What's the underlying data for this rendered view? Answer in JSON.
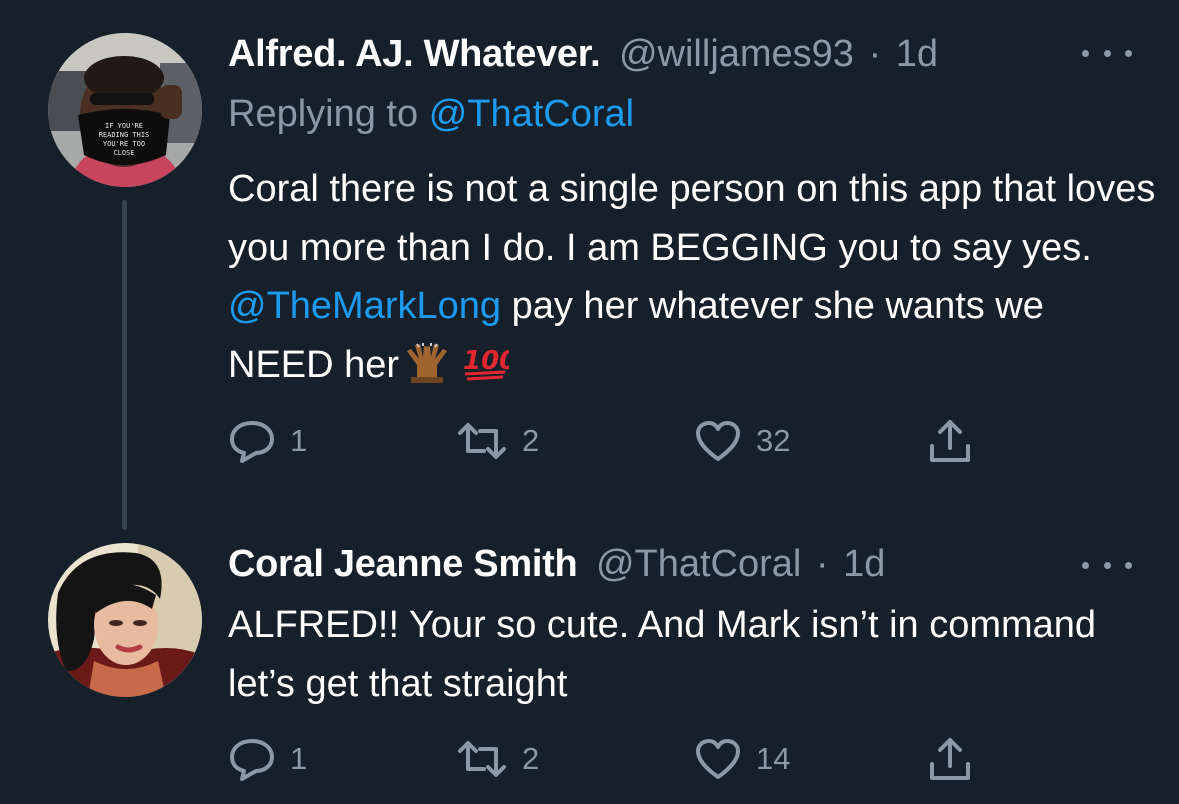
{
  "tweets": [
    {
      "display_name": "Alfred. AJ. Whatever.",
      "handle": "@willjames93",
      "separator": "·",
      "time": "1d",
      "replying_prefix": "Replying to",
      "replying_to": "@ThatCoral",
      "text_part1": "Coral there is not a single person on this app that loves you more than I do. I am BEGGING you to say yes.",
      "mention": "@TheMarkLong",
      "text_part2": "pay her whatever she wants we NEED her",
      "emojis": [
        "raising-hands-emoji",
        "hundred-points-emoji"
      ],
      "replies": "1",
      "retweets": "2",
      "likes": "32",
      "mask_text": "IF YOU'RE READING THIS YOU'RE TOO CLOSE"
    },
    {
      "display_name": "Coral Jeanne Smith",
      "handle": "@ThatCoral",
      "separator": "·",
      "time": "1d",
      "text": "ALFRED!! Your so cute. And Mark isn’t in command let’s get that straight",
      "replies": "1",
      "retweets": "2",
      "likes": "14"
    }
  ],
  "icons": [
    "reply-icon",
    "retweet-icon",
    "like-icon",
    "share-icon",
    "more-icon"
  ],
  "colors": {
    "background": "#15202b",
    "text": "#ffffff",
    "muted": "#8b98a5",
    "link": "#1d9bf0",
    "thread_line": "#38444d"
  }
}
